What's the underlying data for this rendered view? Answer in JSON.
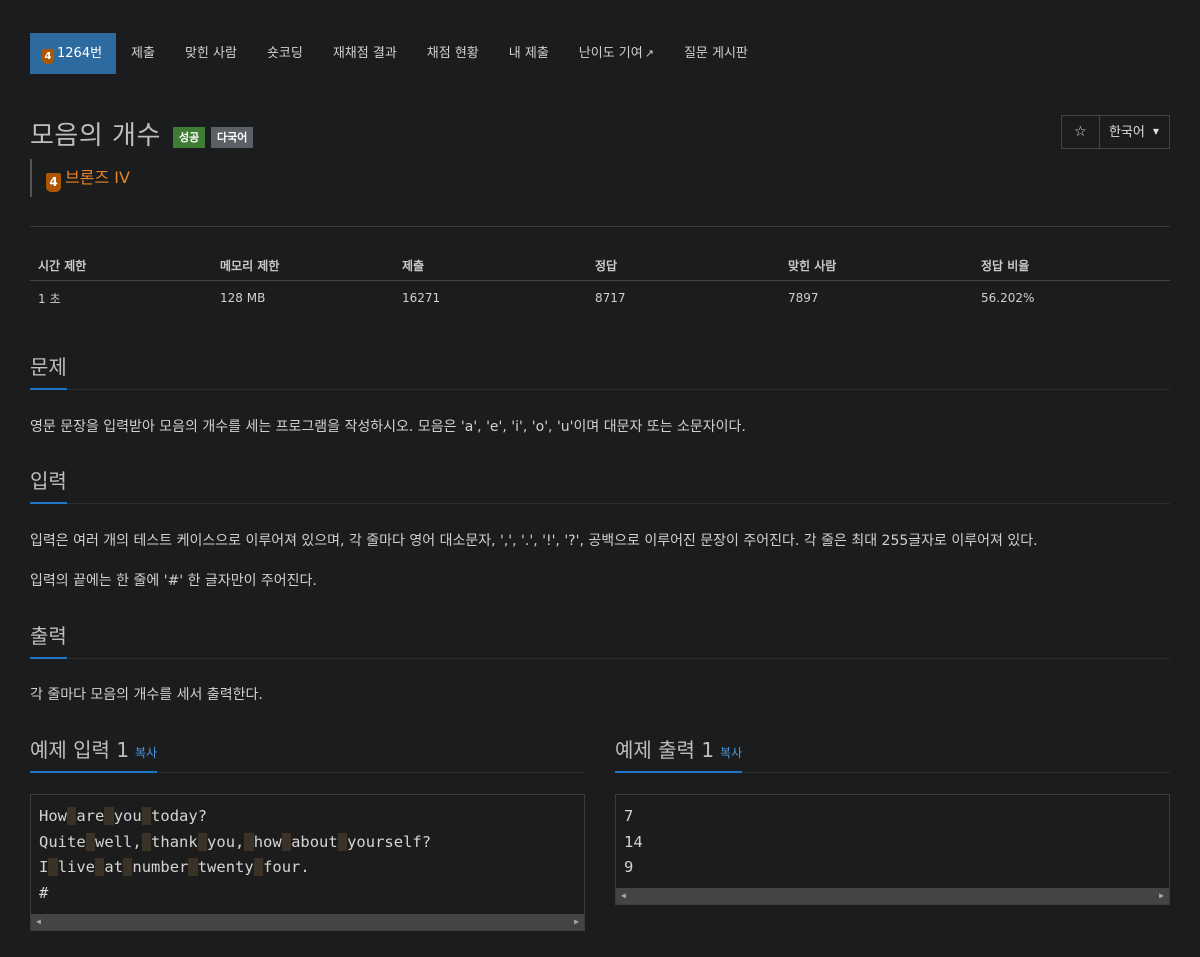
{
  "nav": {
    "problem_tier": "4",
    "items": [
      "1264번",
      "제출",
      "맞힌 사람",
      "숏코딩",
      "재채점 결과",
      "채점 현황",
      "내 제출",
      "난이도 기여",
      "질문 게시판"
    ]
  },
  "problem": {
    "title": "모음의 개수",
    "badges": [
      "성공",
      "다국어"
    ],
    "tier_num": "4",
    "tier_name": "브론즈 IV",
    "star": "☆",
    "language": "한국어"
  },
  "stats": {
    "headers": [
      "시간 제한",
      "메모리 제한",
      "제출",
      "정답",
      "맞힌 사람",
      "정답 비율"
    ],
    "values": [
      "1 초",
      "128 MB",
      "16271",
      "8717",
      "7897",
      "56.202%"
    ]
  },
  "sections": {
    "problem_title": "문제",
    "problem_text": "영문 문장을 입력받아 모음의 개수를 세는 프로그램을 작성하시오. 모음은 'a', 'e', 'i', 'o', 'u'이며 대문자 또는 소문자이다.",
    "input_title": "입력",
    "input_text_1": "입력은 여러 개의 테스트 케이스으로 이루어져 있으며, 각 줄마다 영어 대소문자, ',', '.', '!', '?', 공백으로 이루어진 문장이 주어진다. 각 줄은 최대 255글자로 이루어져 있다.",
    "input_text_2": "입력의 끝에는 한 줄에 '#' 한 글자만이 주어진다.",
    "output_title": "출력",
    "output_text": "각 줄마다 모음의 개수를 세서 출력한다."
  },
  "samples": {
    "input_title": "예제 입력 1",
    "output_title": "예제 출력 1",
    "copy_label": "복사",
    "input_lines": [
      [
        "How",
        "are",
        "you",
        "today?"
      ],
      [
        "Quite",
        "well,",
        "thank",
        "you,",
        "how",
        "about",
        "yourself?"
      ],
      [
        "I",
        "live",
        "at",
        "number",
        "twenty",
        "four."
      ],
      [
        "#"
      ]
    ],
    "output_lines": [
      "7",
      "14",
      "9"
    ]
  },
  "colors": {
    "accent": "#1e76c8",
    "nav_active": "#2d6aa0",
    "success": "#3f7d34",
    "bronze": "#ad5600"
  }
}
